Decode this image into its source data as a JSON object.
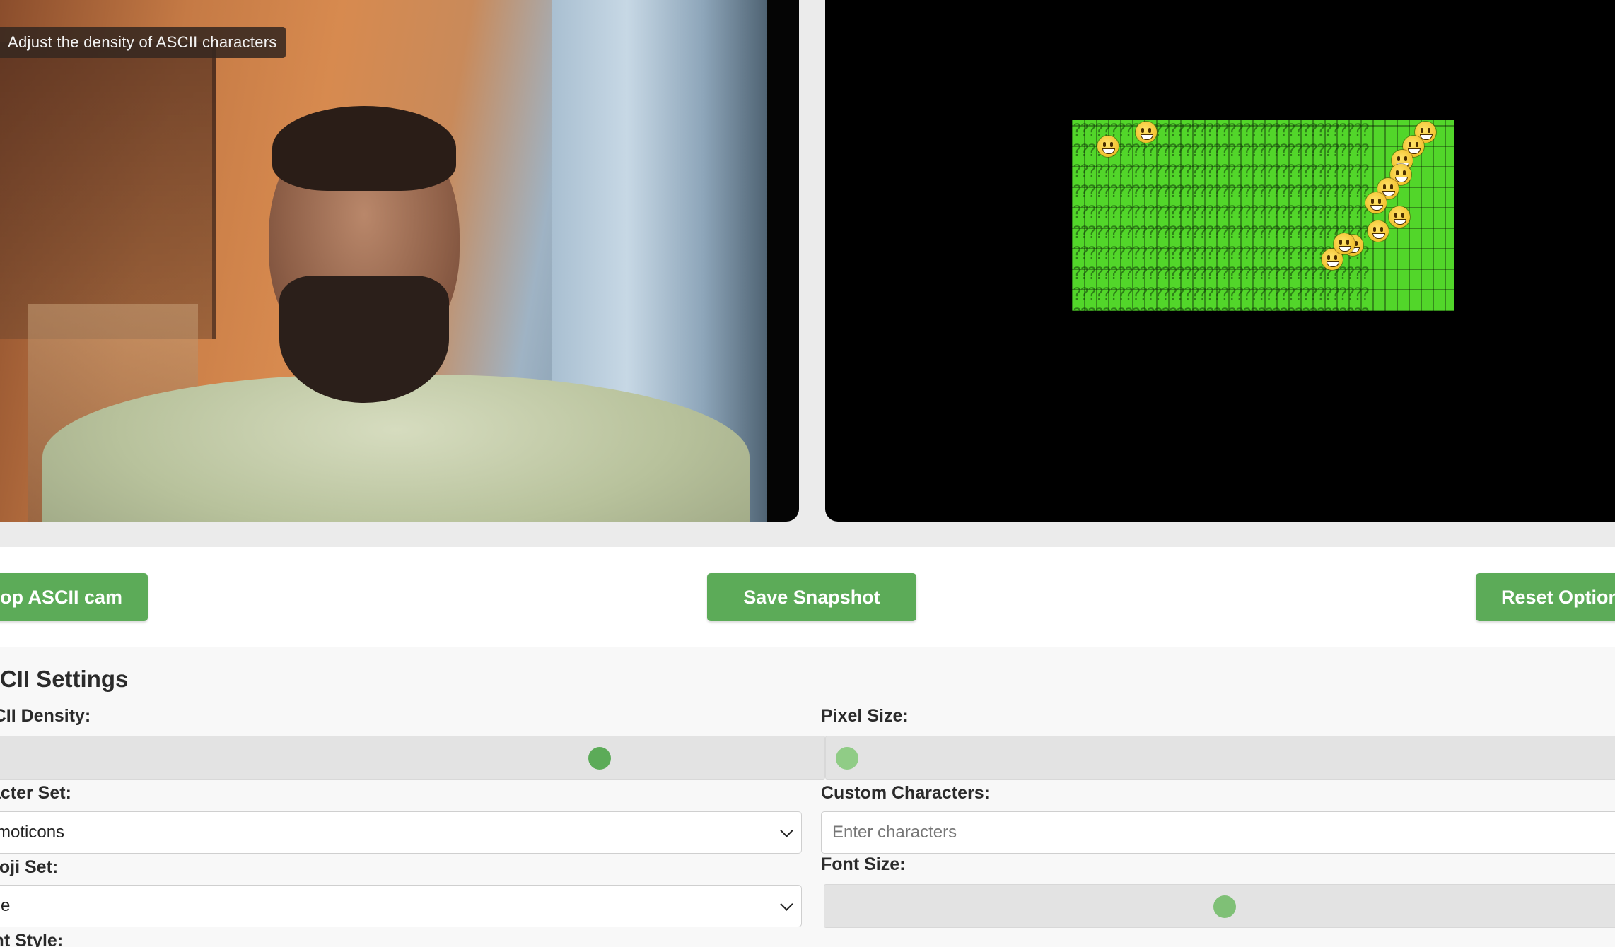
{
  "tooltip": {
    "text": "Adjust the density of ASCII characters"
  },
  "buttons": {
    "stop_label": "Stop ASCII cam",
    "save_label": "Save Snapshot",
    "reset_label": "Reset Options"
  },
  "settings": {
    "title": "ASCII Settings",
    "ascii_density": {
      "label": "ASCII Density:",
      "value_fraction": 0.74
    },
    "pixel_size": {
      "label": "Pixel Size:",
      "value_fraction": 0.0
    },
    "character_set": {
      "label": "Character Set:",
      "selected": "Emoticons"
    },
    "custom_characters": {
      "label": "Custom Characters:",
      "placeholder": "Enter characters",
      "value": ""
    },
    "emoji_set": {
      "label": "Emoji Set:",
      "selected": "None"
    },
    "font_size": {
      "label": "Font Size:",
      "value_fraction": 0.5
    },
    "next_label": "Font Style:"
  },
  "colors": {
    "accent": "#5cab58",
    "ascii_foreground": "#52d62a",
    "ascii_background": "#000000"
  },
  "icons": [
    "chevron-down-icon",
    "smiley-emoji-icon"
  ]
}
